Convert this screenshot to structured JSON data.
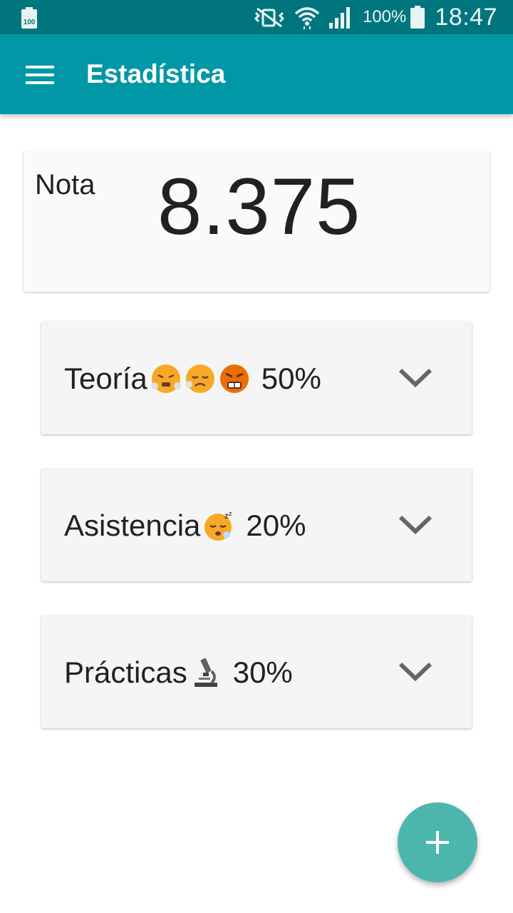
{
  "status_bar": {
    "battery_level_icon": "100",
    "battery_percent": "100%",
    "time": "18:47",
    "icons": [
      "battery-full-icon",
      "vibrate-mute-icon",
      "wifi-icon",
      "cell-signal-icon",
      "battery-icon"
    ]
  },
  "app_bar": {
    "title": "Estadística",
    "menu_icon": "hamburger-menu-icon"
  },
  "grade_card": {
    "label": "Nota",
    "value": "8.375"
  },
  "categories": [
    {
      "label": "Teoría",
      "percent": "50%",
      "emojis": [
        "huffing-face-emoji",
        "sad-relieved-face-emoji",
        "angry-face-emoji"
      ]
    },
    {
      "label": "Asistencia",
      "percent": "20%",
      "emojis": [
        "sleeping-face-emoji"
      ]
    },
    {
      "label": "Prácticas",
      "percent": "30%",
      "emojis": [
        "microscope-emoji"
      ]
    }
  ],
  "fab": {
    "icon": "plus-icon"
  },
  "colors": {
    "status_bar": "#00757e",
    "app_bar": "#0097a7",
    "fab": "#4db6ac",
    "card": "#f5f5f5",
    "text": "#212121",
    "chevron": "#666666"
  }
}
